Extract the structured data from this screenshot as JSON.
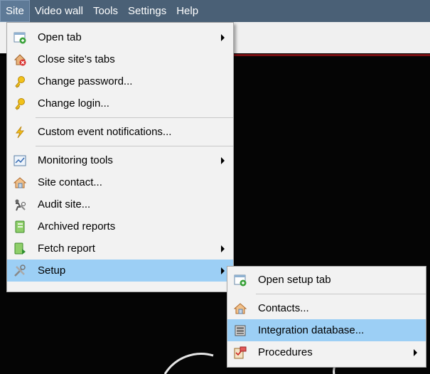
{
  "menubar": {
    "items": [
      {
        "label": "Site",
        "active": true
      },
      {
        "label": "Video wall"
      },
      {
        "label": "Tools"
      },
      {
        "label": "Settings"
      },
      {
        "label": "Help"
      }
    ]
  },
  "site_menu": {
    "items": [
      {
        "label": "Open tab",
        "icon": "open-tab-icon",
        "submenu": true
      },
      {
        "label": "Close site's tabs",
        "icon": "close-tabs-icon"
      },
      {
        "label": "Change password...",
        "icon": "key-icon"
      },
      {
        "label": "Change login...",
        "icon": "key-icon"
      },
      {
        "label": "Custom event notifications...",
        "icon": "lightning-icon"
      },
      {
        "label": "Monitoring tools",
        "icon": "monitor-chart-icon",
        "submenu": true
      },
      {
        "label": "Site contact...",
        "icon": "house-contact-icon"
      },
      {
        "label": "Audit site...",
        "icon": "audit-icon"
      },
      {
        "label": "Archived reports",
        "icon": "report-book-icon"
      },
      {
        "label": "Fetch report",
        "icon": "fetch-report-icon",
        "submenu": true
      },
      {
        "label": "Setup",
        "icon": "tools-icon",
        "submenu": true,
        "highlighted": true
      }
    ]
  },
  "setup_menu": {
    "items": [
      {
        "label": "Open setup tab",
        "icon": "open-tab-icon"
      },
      {
        "label": "Contacts...",
        "icon": "house-contact-icon"
      },
      {
        "label": "Integration database...",
        "icon": "database-icon",
        "highlighted": true
      },
      {
        "label": "Procedures",
        "icon": "procedures-icon",
        "submenu": true
      }
    ]
  },
  "colors": {
    "menubar_bg": "#4a6076",
    "menu_bg": "#f2f2f2",
    "highlight": "#9ccff5"
  }
}
